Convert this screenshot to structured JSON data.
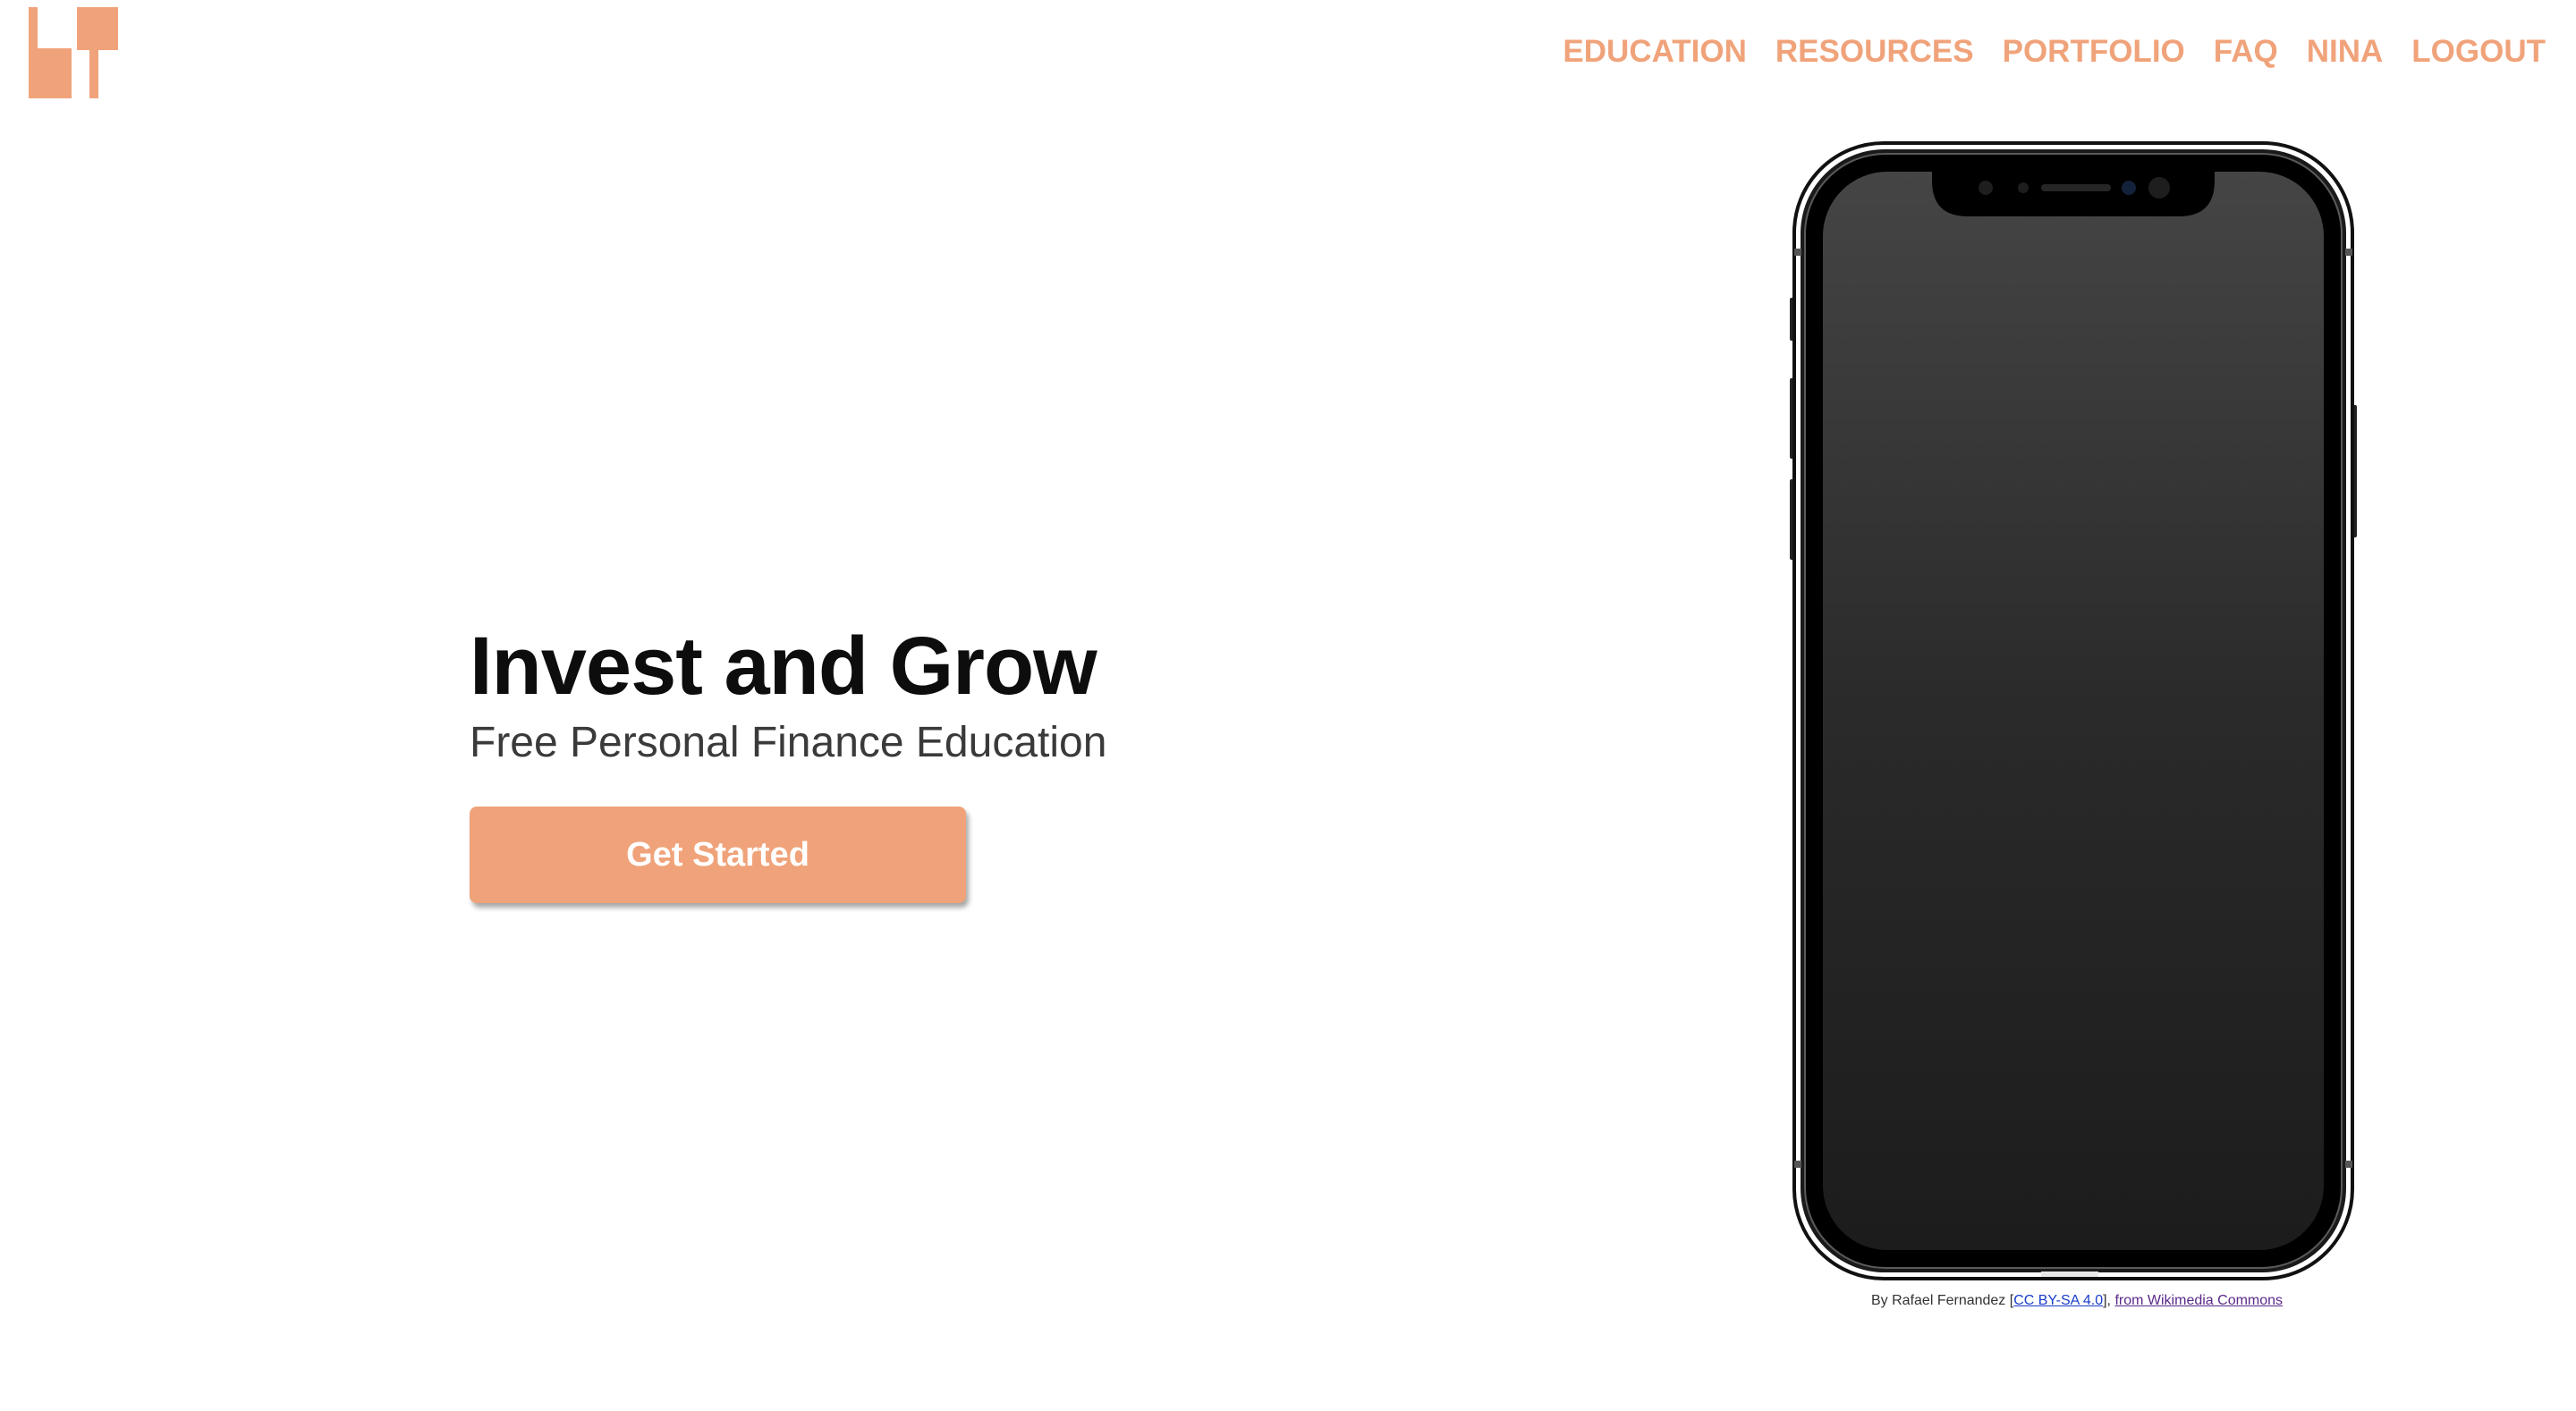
{
  "brand": {
    "accent_color": "#f0a37a",
    "logo_icon": "site-logo-icon"
  },
  "nav": {
    "items": [
      {
        "label": "EDUCATION"
      },
      {
        "label": "RESOURCES"
      },
      {
        "label": "PORTFOLIO"
      },
      {
        "label": "FAQ"
      },
      {
        "label": "NINA"
      },
      {
        "label": "LOGOUT"
      }
    ]
  },
  "hero": {
    "title": "Invest and Grow",
    "subtitle": "Free Personal Finance Education",
    "cta_label": "Get Started"
  },
  "phone": {
    "icon": "smartphone-illustration"
  },
  "credit": {
    "prefix": "By Rafael Fernandez [",
    "license_link": "CC BY-SA 4.0",
    "separator": "], ",
    "source_link": "from Wikimedia Commons"
  }
}
